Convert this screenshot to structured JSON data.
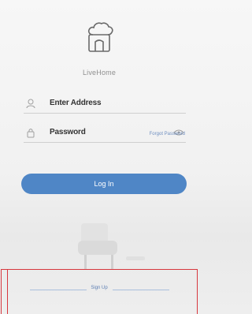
{
  "app": {
    "brand": "LiveHome"
  },
  "login_form": {
    "address": {
      "value": "Enter Address",
      "icon": "user-icon"
    },
    "password": {
      "value": "Password",
      "icon": "lock-icon",
      "toggle_icon": "eye-icon"
    },
    "forgot_link": "Forgot Password",
    "login_button": "Log In"
  },
  "footer": {
    "signup_link": "Sign Up"
  },
  "colors": {
    "accent": "#4f86c6",
    "highlight": "#d7373e",
    "link": "#6f8fc0"
  }
}
